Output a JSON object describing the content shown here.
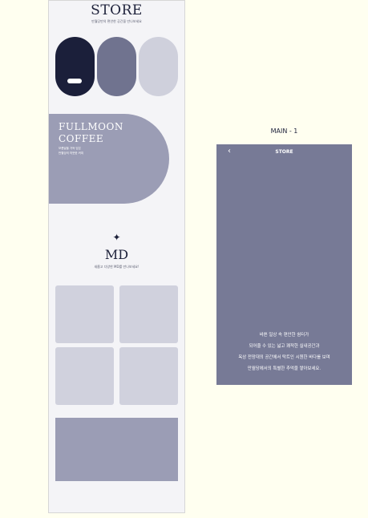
{
  "left_page": {
    "store_title": "STORE",
    "store_subtitle": "만월당만의 편안한 공간을 만나보세요",
    "brand_line1": "FULLMOON",
    "brand_line2": "COFFEE",
    "brand_small1": "보름달을 가득 담은",
    "brand_small2": "만월당의 따뜻한 커피",
    "sparkle": "✦",
    "md_title": "MD",
    "md_subtitle": "새롭고 다양한 MD를 만나보세요!"
  },
  "caption": "MAIN - 1",
  "phone": {
    "back_icon": "‹",
    "title": "STORE",
    "body_lines": [
      "바쁜 일상 속 편안한 쉼터가",
      "되어줄 수 있는 넓고 쾌적한 실내공간과",
      "옥상 전망대의 공간에서 탁트인 시원한 바다를 보며",
      "만월당에서의 특별한 추억을 쌓아보세요."
    ]
  },
  "colors": {
    "navy": "#1b1f3a",
    "slate": "#70738f",
    "light_lavender": "#cfd0dc",
    "lavender": "#9b9db5",
    "phone_bg": "#777a96",
    "page_bg": "#fffff0"
  }
}
